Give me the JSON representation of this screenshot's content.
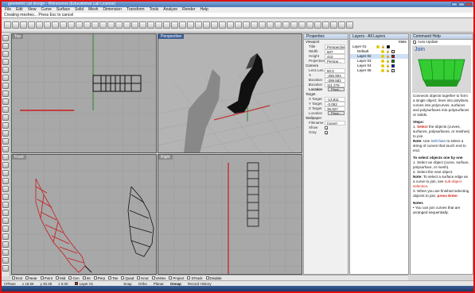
{
  "window": {
    "title": "geometric cat design - Rhinoceros (Educational Lab License)"
  },
  "menu": [
    "File",
    "Edit",
    "View",
    "Curve",
    "Surface",
    "Solid",
    "Mesh",
    "Dimension",
    "Transform",
    "Tools",
    "Analyze",
    "Render",
    "Help"
  ],
  "command": {
    "prompt": "Creating meshes... Press Esc to cancel"
  },
  "viewports": {
    "top": "Top",
    "perspective": "Perspective",
    "front": "Front",
    "right": "Right"
  },
  "properties": {
    "title": "Properties",
    "section_viewport": "Viewport",
    "rows_viewport": [
      {
        "k": "Title",
        "v": "Perspective"
      },
      {
        "k": "Width",
        "v": "507"
      },
      {
        "k": "Height",
        "v": "410"
      },
      {
        "k": "Projection",
        "v": "Perspe..."
      }
    ],
    "section_camera": "Camera",
    "rows_camera": [
      {
        "k": "Lens Len.",
        "v": "50.0"
      },
      {
        "k": "X Location",
        "v": "-256.904"
      },
      {
        "k": "Y Location",
        "v": "-299.582"
      },
      {
        "k": "Z Location",
        "v": "111.276"
      }
    ],
    "camera_location_label": "Location",
    "place_label": "Place...",
    "section_target": "Target",
    "rows_target": [
      {
        "k": "X Target",
        "v": "-13.811"
      },
      {
        "k": "Y Target",
        "v": "-0.053"
      },
      {
        "k": "Z Target",
        "v": "36.927"
      }
    ],
    "target_location_label": "Location",
    "section_wallpaper": "Wallpaper",
    "filename_label": "Filename",
    "filename_value": "(none)",
    "show_label": "Show",
    "gray_label": "Gray"
  },
  "layers": {
    "title": "Layers - All Layers",
    "mat_header": "Mate",
    "items": [
      {
        "name": "Layer 01",
        "color": "#000000"
      },
      {
        "name": "Default",
        "color": "#ffffff"
      },
      {
        "name": "Layer 02",
        "color": "#ff0000"
      },
      {
        "name": "Layer 03",
        "color": "#00a000"
      },
      {
        "name": "Layer 04",
        "color": "#0000ff"
      },
      {
        "name": "Layer 05",
        "color": "#ffffff"
      }
    ]
  },
  "help": {
    "title": "Command Help",
    "auto_update": "Auto-Update",
    "command": "Join",
    "description": "Connects objects together to form a single object: lines into polylines, curves into polycurves, surfaces and polysurfaces into polysurfaces or solids.",
    "steps_title": "Steps:",
    "step1_a": "Select",
    "step1_b": "the objects (curves, surfaces, polysurfaces, or meshes) to join.",
    "note1_a": "Note:",
    "note1_b": "Use",
    "note1_link": "SelChain",
    "note1_c": "to select a string of curves that touch end to end.",
    "one_by_one": "To select objects one by one",
    "s1": "Select an object (curve, surface, polysurface, or mesh).",
    "s2": "Select the next object.",
    "note2_a": "Note:",
    "note2_b": "To select a surface edge as a curve to join, see",
    "note2_link": "sub-object selection",
    "s3_a": "When you are finished selecting objects to join,",
    "s3_b": "press Enter.",
    "notes_title": "Notes",
    "note3": "You can join curves that are arranged sequentially."
  },
  "osnaps": [
    "End",
    "Near",
    "Point",
    "Mid",
    "Cen",
    "Int",
    "Perp",
    "Tan",
    "Quad",
    "Knot",
    "Vertex",
    "Project",
    "STrack",
    "Disable"
  ],
  "status": {
    "cplane": "CPlane",
    "x": "x 18.56",
    "y": "y 30.28",
    "z": "z 0.00",
    "layer": "Layer 01",
    "toggles": [
      "Snap",
      "Ortho",
      "Planar",
      "Osnap",
      "Record History"
    ]
  },
  "colors": {
    "accent": "#3d5e96",
    "border_red": "#dd1111",
    "help_green": "#33cc33"
  }
}
